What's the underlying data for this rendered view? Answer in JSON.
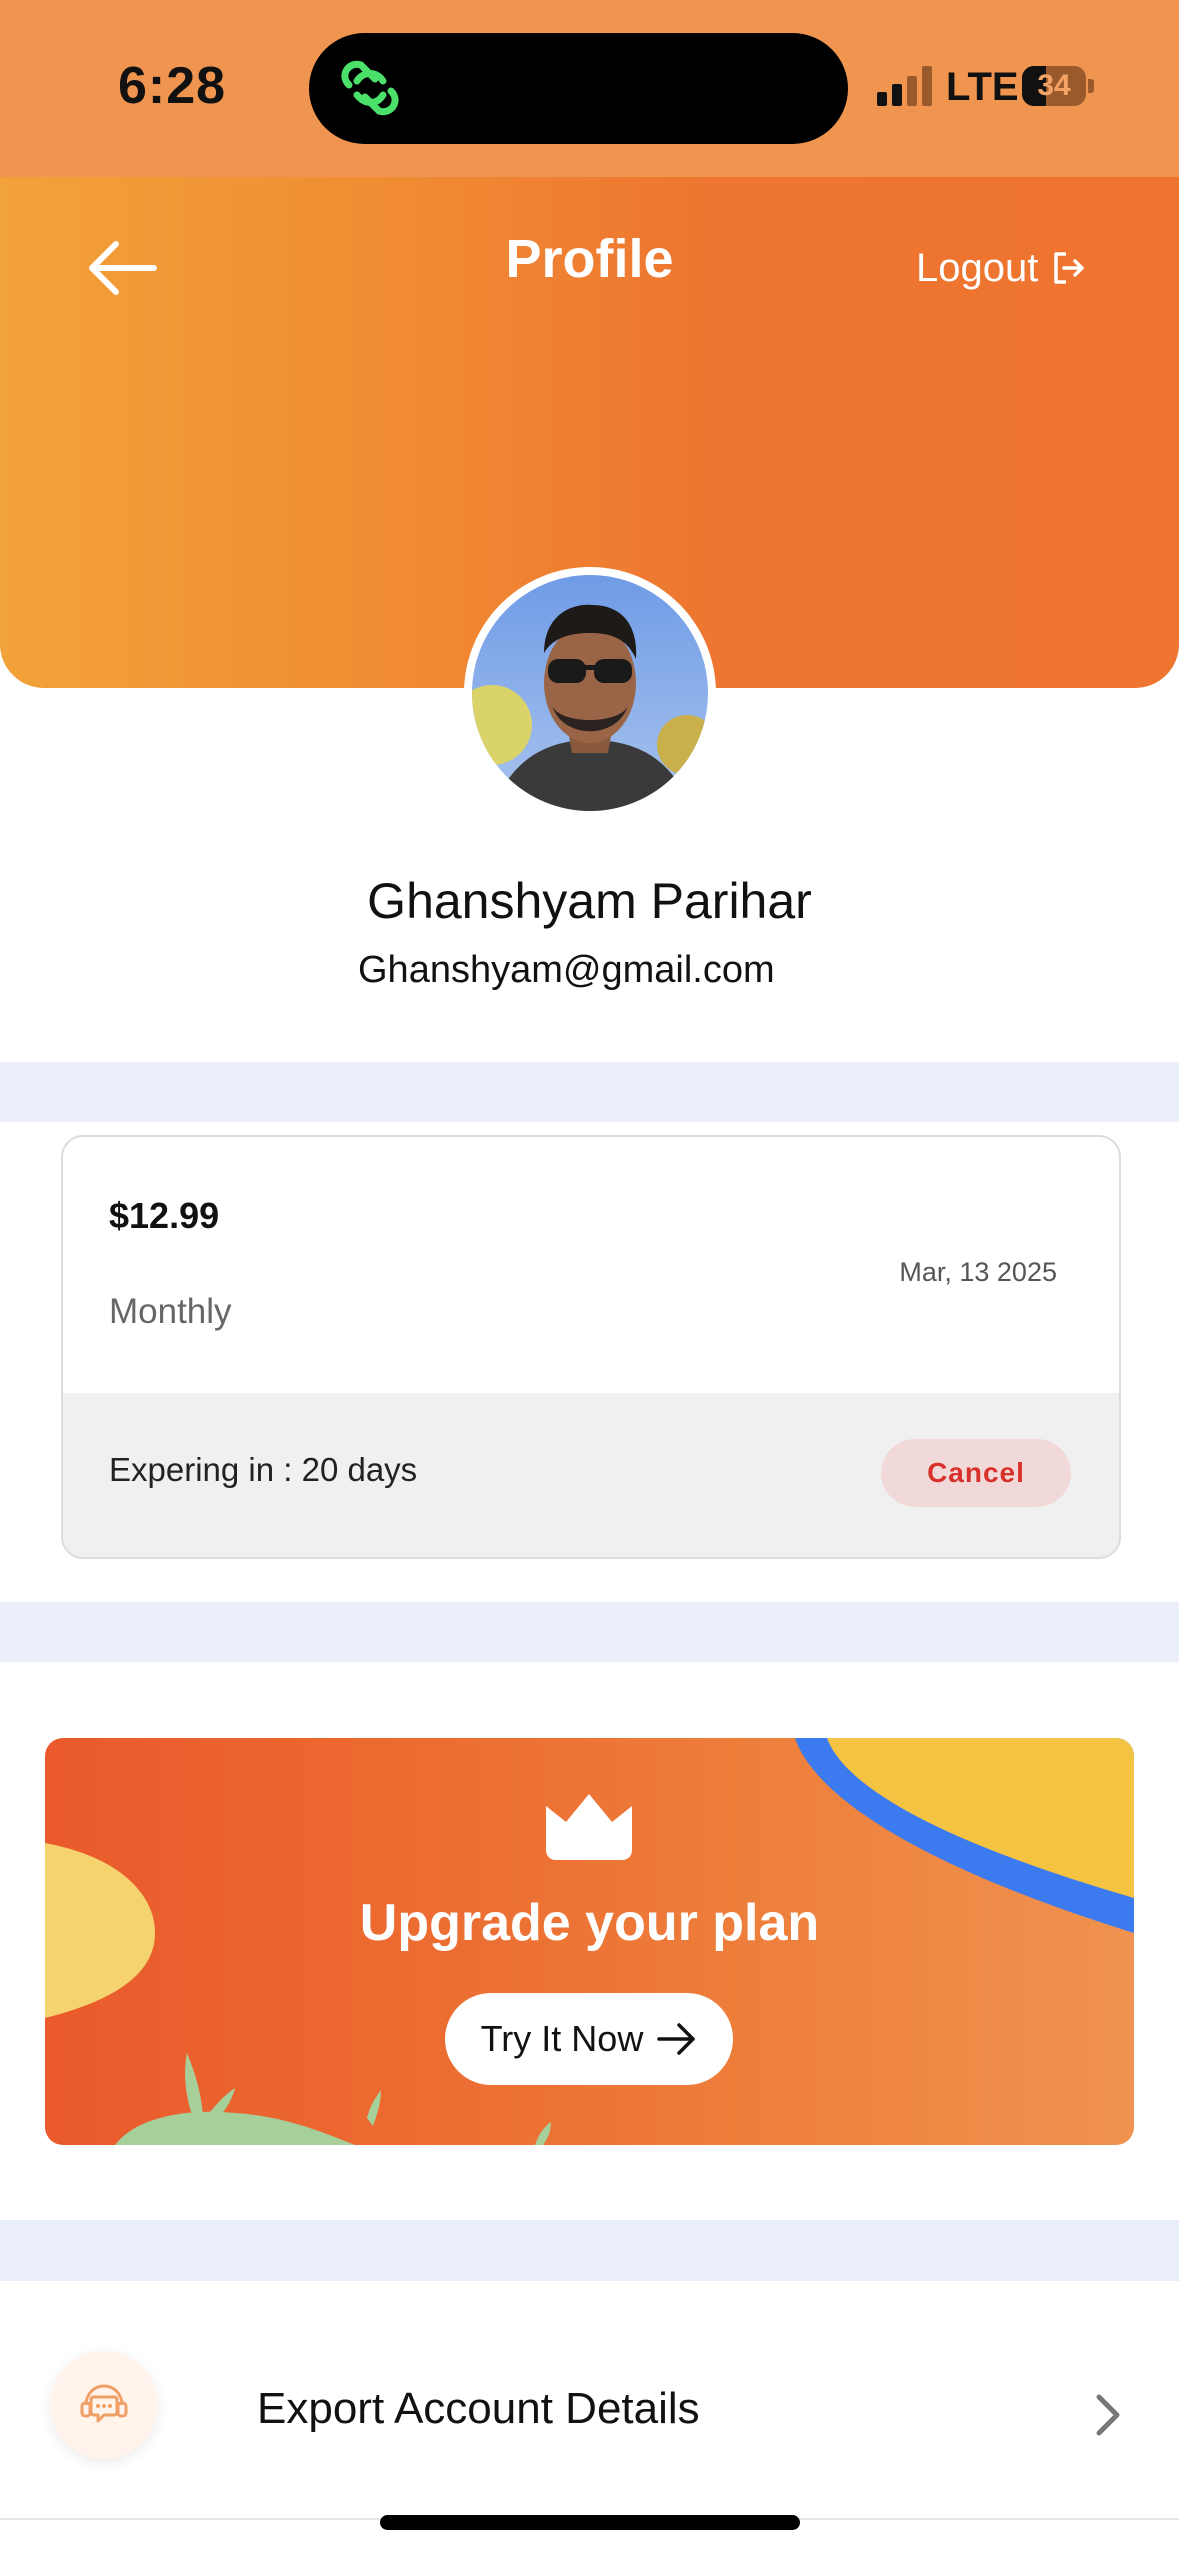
{
  "status_bar": {
    "time": "6:28",
    "network": "LTE",
    "battery": "34"
  },
  "header": {
    "title": "Profile",
    "logout_label": "Logout",
    "background": "#ef7a31"
  },
  "profile": {
    "name": "Ghanshyam Parihar",
    "email": "Ghanshyam@gmail.com"
  },
  "subscription": {
    "price": "$12.99",
    "period": "Monthly",
    "date": "Mar, 13 2025",
    "expiry": "Expering in : 20 days",
    "cancel_label": "Cancel"
  },
  "upgrade": {
    "title": "Upgrade your plan",
    "button_label": "Try It Now"
  },
  "menu": {
    "export_label": "Export Account Details"
  },
  "icons": {
    "back": "arrow-left-icon",
    "logout": "logout-icon",
    "crown": "crown-icon",
    "arrow_right": "arrow-right-icon",
    "support": "support-chat-icon",
    "chevron": "chevron-right-icon"
  },
  "colors": {
    "accent": "#ee7430",
    "cancel_text": "#d8302b",
    "band": "#eaeefb"
  }
}
